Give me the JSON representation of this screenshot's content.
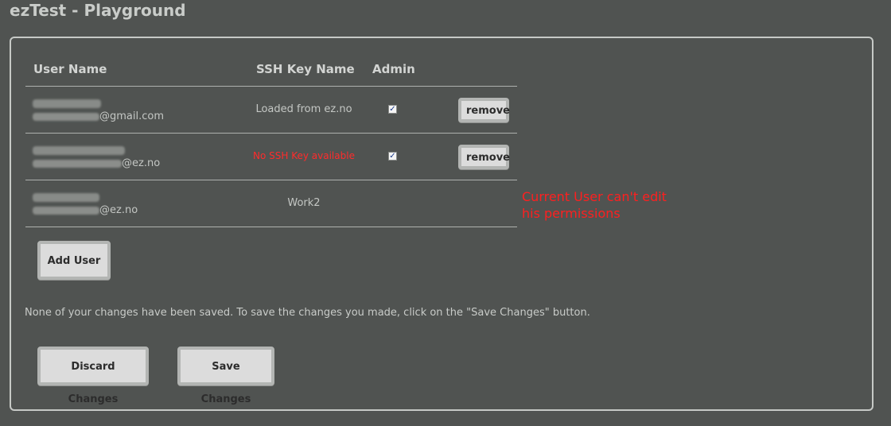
{
  "app": {
    "title": "ezTest - Playground"
  },
  "table": {
    "headers": {
      "user_name": "User Name",
      "ssh_key_name": "SSH Key Name",
      "admin": "Admin"
    },
    "rows": [
      {
        "email_domain": "@gmail.com",
        "ssh_key": "Loaded from ez.no",
        "admin": true,
        "remove_label": "remove"
      },
      {
        "email_domain": "@ez.no",
        "ssh_key": "No SSH Key available",
        "admin": true,
        "remove_label": "remove"
      },
      {
        "email_domain": "@ez.no",
        "ssh_key": "Work2"
      }
    ]
  },
  "notes": {
    "current_user": "Current User can't edit his permissions"
  },
  "actions": {
    "add_user": "Add User",
    "discard": "Discard Changes",
    "save": "Save Changes"
  },
  "messages": {
    "unsaved": "None of your changes have been saved. To save the changes you made, click on the \"Save Changes\" button."
  },
  "colors": {
    "background": "#505351",
    "warning": "#ff1f1f",
    "button": "#dcdcdc"
  }
}
